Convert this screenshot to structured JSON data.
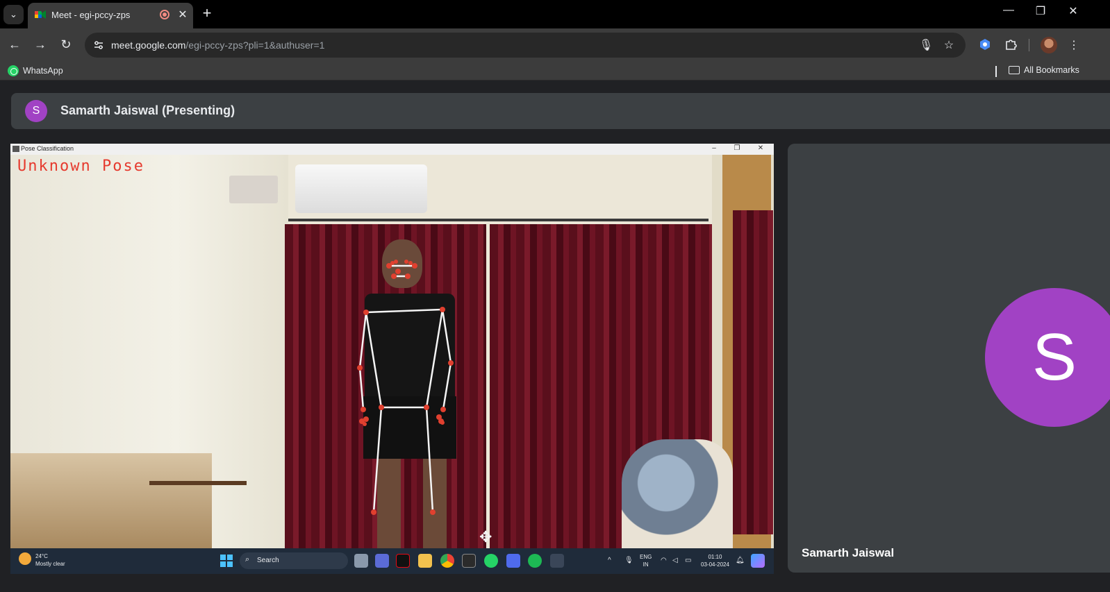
{
  "browser": {
    "tab": {
      "title": "Meet - egi-pccy-zps"
    },
    "url": {
      "host": "meet.google.com",
      "path": "/egi-pccy-zps?pli=1&authuser=1"
    },
    "bookmarks": {
      "whatsapp": "WhatsApp",
      "all": "All Bookmarks"
    },
    "icons": [
      "tab-search-icon",
      "meet-favicon",
      "recording-icon",
      "close-icon",
      "new-tab-icon",
      "minimize-icon",
      "restore-icon",
      "close-window-icon",
      "back-icon",
      "forward-icon",
      "reload-icon",
      "site-info-icon",
      "mic-icon",
      "star-icon",
      "extension-icon",
      "puzzle-icon",
      "profile-avatar",
      "menu-icon"
    ]
  },
  "meet": {
    "presenter": {
      "initial": "S",
      "label": "Samarth Jaiswal (Presenting)"
    },
    "shared_window": {
      "title": "Pose Classification",
      "pose_label": "Unknown Pose"
    },
    "taskbar": {
      "weather_temp": "24°C",
      "weather_desc": "Mostly clear",
      "search": "Search",
      "lang_top": "ENG",
      "lang_bottom": "IN",
      "time": "01:10",
      "date": "03-04-2024"
    },
    "participant": {
      "initial": "S",
      "name": "Samarth Jaiswal"
    }
  },
  "colors": {
    "accent_purple": "#a142c4",
    "pose_red": "#e63a2e",
    "meet_bg": "#202124",
    "tile_bg": "#3c4043"
  }
}
